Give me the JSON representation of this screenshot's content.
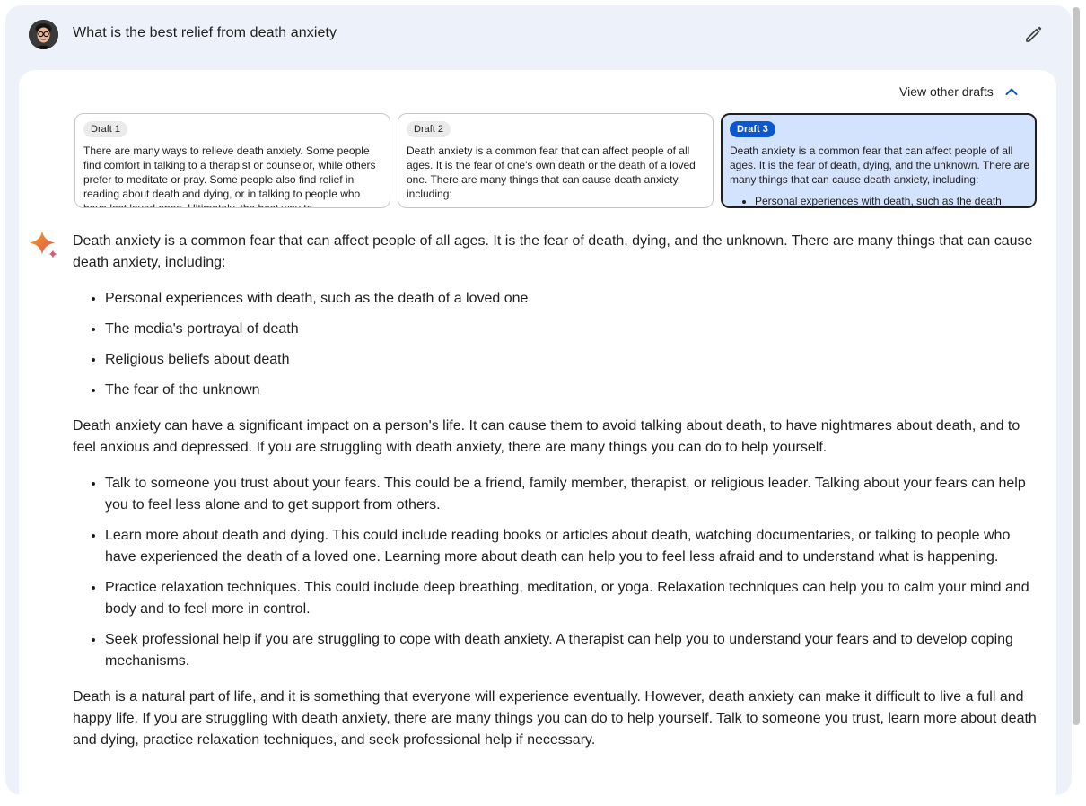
{
  "query": {
    "text": "What is the best relief from death anxiety",
    "avatar_icon": "avatar-icon",
    "edit_icon": "pencil-icon"
  },
  "drafts_toggle": {
    "label": "View other drafts",
    "icon": "chevron-up-icon",
    "color": "#0b57d0"
  },
  "drafts": [
    {
      "label": "Draft 1",
      "text": "There are many ways to relieve death anxiety. Some people find comfort in talking to a therapist or counselor, while others prefer to meditate or pray. Some people also find relief in reading about death and dying, or in talking to people who have lost loved ones. Ultimately, the best way to",
      "bullet": ""
    },
    {
      "label": "Draft 2",
      "text": "Death anxiety is a common fear that can affect people of all ages. It is the fear of one's own death or the death of a loved one. There are many things that can cause death anxiety, including:",
      "bullet": ""
    },
    {
      "label": "Draft 3",
      "text": "Death anxiety is a common fear that can affect people of all ages. It is the fear of death, dying, and the unknown. There are many things that can cause death anxiety, including:",
      "bullet": "Personal experiences with death, such as the death",
      "selected": true,
      "accent": "#0b57d0",
      "background": "#d3e3fd"
    }
  ],
  "response": {
    "icon": "sparkle-icon",
    "intro": "Death anxiety is a common fear that can affect people of all ages. It is the fear of death, dying, and the unknown. There are many things that can cause death anxiety, including:",
    "causes": [
      "Personal experiences with death, such as the death of a loved one",
      "The media's portrayal of death",
      "Religious beliefs about death",
      "The fear of the unknown"
    ],
    "impact": "Death anxiety can have a significant impact on a person's life. It can cause them to avoid talking about death, to have nightmares about death, and to feel anxious and depressed. If you are struggling with death anxiety, there are many things you can do to help yourself.",
    "tips": [
      "Talk to someone you trust about your fears. This could be a friend, family member, therapist, or religious leader. Talking about your fears can help you to feel less alone and to get support from others.",
      "Learn more about death and dying. This could include reading books or articles about death, watching documentaries, or talking to people who have experienced the death of a loved one. Learning more about death can help you to feel less afraid and to understand what is happening.",
      "Practice relaxation techniques. This could include deep breathing, meditation, or yoga. Relaxation techniques can help you to calm your mind and body and to feel more in control.",
      "Seek professional help if you are struggling to cope with death anxiety. A therapist can help you to understand your fears and to develop coping mechanisms."
    ],
    "conclusion": "Death is a natural part of life, and it is something that everyone will experience eventually. However, death anxiety can make it difficult to live a full and happy life. If you are struggling with death anxiety, there are many things you can do to help yourself. Talk to someone you trust, learn more about death and dying, practice relaxation techniques, and seek professional help if necessary."
  }
}
